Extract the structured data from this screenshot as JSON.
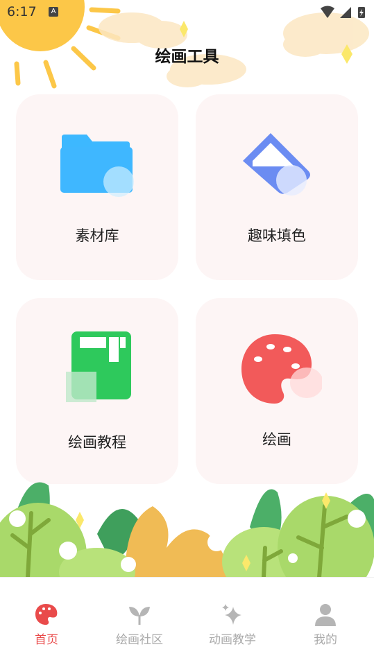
{
  "status_bar": {
    "time": "6:17",
    "notification_icon": "A"
  },
  "header": {
    "title": "绘画工具"
  },
  "cards": [
    {
      "label": "素材库",
      "icon": "folder-icon"
    },
    {
      "label": "趣味填色",
      "icon": "paint-bucket-icon"
    },
    {
      "label": "绘画教程",
      "icon": "book-icon"
    },
    {
      "label": "绘画",
      "icon": "palette-icon"
    }
  ],
  "bottom_nav": {
    "items": [
      {
        "label": "首页",
        "icon": "palette-icon",
        "active": true
      },
      {
        "label": "绘画社区",
        "icon": "sprout-icon",
        "active": false
      },
      {
        "label": "动画教学",
        "icon": "sparkle-icon",
        "active": false
      },
      {
        "label": "我的",
        "icon": "person-icon",
        "active": false
      }
    ]
  },
  "colors": {
    "accent": "#e94b4b",
    "card_bg": "#fdf5f5",
    "folder": "#3db8ff",
    "bucket": "#6b8cf2",
    "book": "#2ec95c",
    "palette": "#f25a5a",
    "sun": "#fcc748"
  }
}
